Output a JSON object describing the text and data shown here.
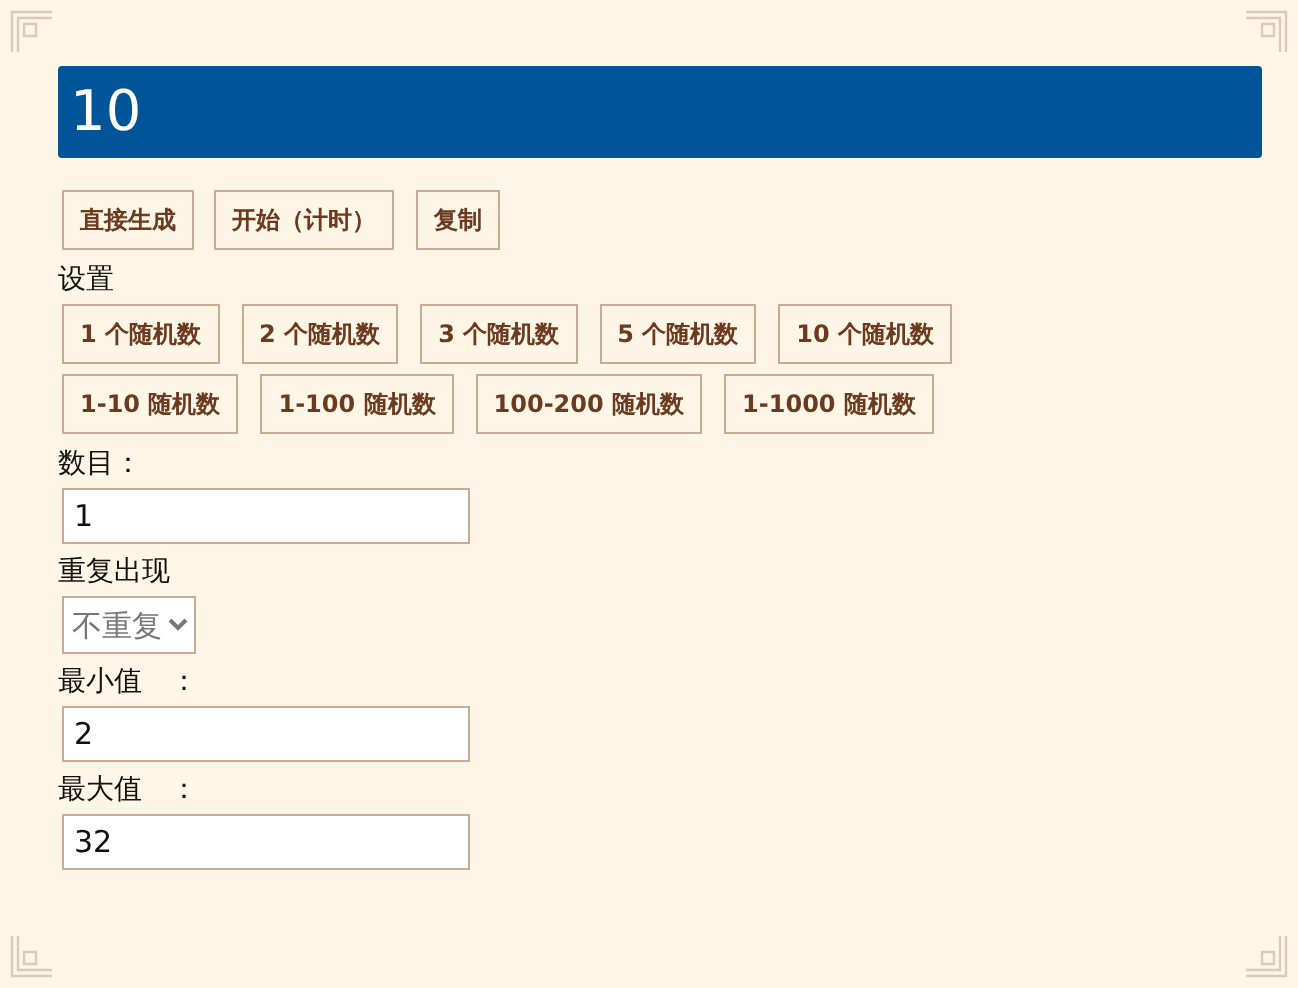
{
  "result": {
    "value": "10"
  },
  "actions": [
    "直接生成",
    "开始（计时）",
    "复制"
  ],
  "settings_label": "设置",
  "preset_rows": [
    [
      "1 个随机数",
      "2 个随机数",
      "3 个随机数",
      "5 个随机数",
      "10 个随机数"
    ],
    [
      "1-10 随机数",
      "1-100 随机数",
      "100-200 随机数",
      "1-1000 随机数"
    ]
  ],
  "fields": [
    {
      "kind": "input",
      "label": "数目：",
      "value": "1"
    },
    {
      "kind": "select",
      "label": "重复出现",
      "value": "不重复"
    },
    {
      "kind": "input",
      "label": "最小值　：",
      "value": "2"
    },
    {
      "kind": "input",
      "label": "最大值　：",
      "value": "32"
    }
  ]
}
